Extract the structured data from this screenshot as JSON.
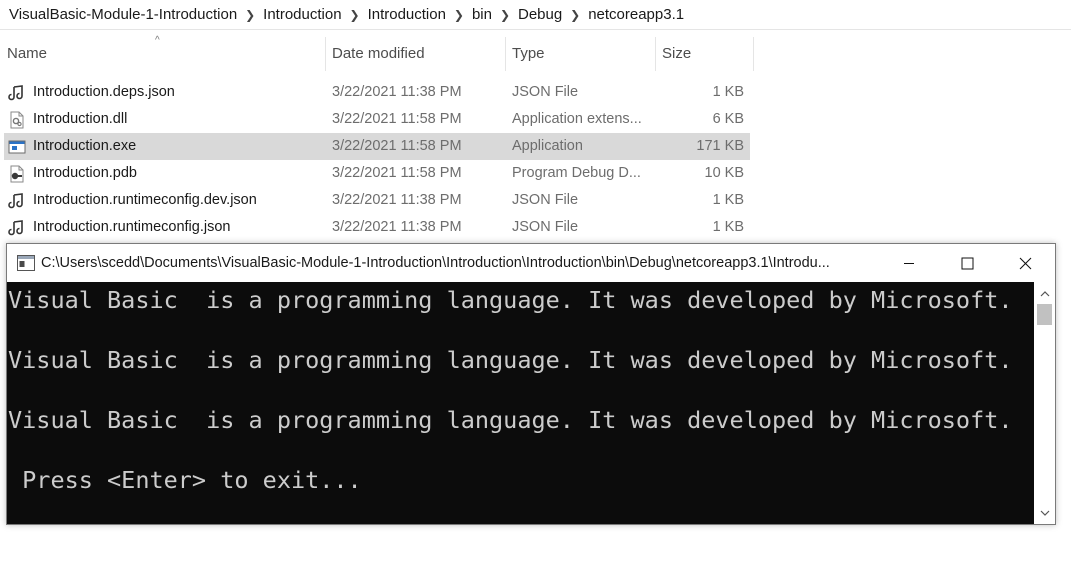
{
  "breadcrumb": [
    "VisualBasic-Module-1-Introduction",
    "Introduction",
    "Introduction",
    "bin",
    "Debug",
    "netcoreapp3.1"
  ],
  "columns": {
    "name": "Name",
    "date": "Date modified",
    "type": "Type",
    "size": "Size",
    "sort_indicator": "^"
  },
  "files": [
    {
      "name": "Introduction.deps.json",
      "date": "3/22/2021 11:38 PM",
      "type": "JSON File",
      "size": "1 KB",
      "icon": "json-file-icon"
    },
    {
      "name": "Introduction.dll",
      "date": "3/22/2021 11:58 PM",
      "type": "Application extens...",
      "size": "6 KB",
      "icon": "dll-file-icon"
    },
    {
      "name": "Introduction.exe",
      "date": "3/22/2021 11:58 PM",
      "type": "Application",
      "size": "171 KB",
      "icon": "exe-file-icon",
      "selected": true
    },
    {
      "name": "Introduction.pdb",
      "date": "3/22/2021 11:58 PM",
      "type": "Program Debug D...",
      "size": "10 KB",
      "icon": "pdb-file-icon"
    },
    {
      "name": "Introduction.runtimeconfig.dev.json",
      "date": "3/22/2021 11:38 PM",
      "type": "JSON File",
      "size": "1 KB",
      "icon": "json-file-icon"
    },
    {
      "name": "Introduction.runtimeconfig.json",
      "date": "3/22/2021 11:38 PM",
      "type": "JSON File",
      "size": "1 KB",
      "icon": "json-file-icon"
    }
  ],
  "console": {
    "title": "C:\\Users\\scedd\\Documents\\VisualBasic-Module-1-Introduction\\Introduction\\Introduction\\bin\\Debug\\netcoreapp3.1\\Introdu...",
    "lines": [
      "Visual Basic  is a programming language. It was developed by Microsoft.",
      "Visual Basic  is a programming language. It was developed by Microsoft.",
      "Visual Basic  is a programming language. It was developed by Microsoft.",
      " Press <Enter> to exit..."
    ]
  },
  "colors": {
    "selection": "#d9d9d9",
    "console_bg": "#0c0c0c",
    "console_text": "#cccccc"
  }
}
